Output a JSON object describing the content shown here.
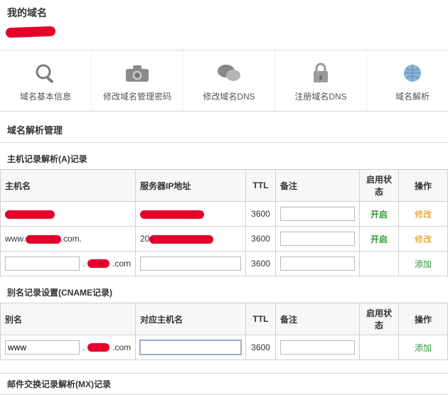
{
  "page": {
    "title": "我的域名"
  },
  "toolbar": {
    "items": [
      {
        "label": "域名基本信息",
        "icon": "magnifier-icon"
      },
      {
        "label": "修改域名管理密码",
        "icon": "camera-icon"
      },
      {
        "label": "修改域名DNS",
        "icon": "bubble-icon"
      },
      {
        "label": "注册域名DNS",
        "icon": "lock-icon"
      },
      {
        "label": "域名解析",
        "icon": "globe-icon"
      }
    ]
  },
  "dns": {
    "section_title": "域名解析管理",
    "a_records": {
      "title": "主机记录解析(A)记录",
      "headers": {
        "host": "主机名",
        "ip": "服务器IP地址",
        "ttl": "TTL",
        "note": "备注",
        "state": "启用状态",
        "op": "操作"
      },
      "rows": [
        {
          "host": "",
          "ip": "",
          "ttl": "3600",
          "note": "",
          "state": "开启",
          "op": "修改"
        },
        {
          "host": "www.",
          "host_suffix": ".com.",
          "ip": "20",
          "ttl": "3600",
          "note": "",
          "state": "开启",
          "op": "修改"
        },
        {
          "host_input": "",
          "host_suffix": ".com",
          "ip": "",
          "ttl": "3600",
          "note": "",
          "state": "",
          "op": "添加"
        }
      ]
    },
    "cname_records": {
      "title": "别名记录设置(CNAME记录)",
      "headers": {
        "alias": "别名",
        "target": "对应主机名",
        "ttl": "TTL",
        "note": "备注",
        "state": "启用状态",
        "op": "操作"
      },
      "rows": [
        {
          "alias": "www",
          "alias_suffix": ".com",
          "target": "",
          "ttl": "3600",
          "note": "",
          "state": "",
          "op": "添加"
        }
      ]
    },
    "mx_records": {
      "title": "邮件交换记录解析(MX)记录"
    }
  }
}
